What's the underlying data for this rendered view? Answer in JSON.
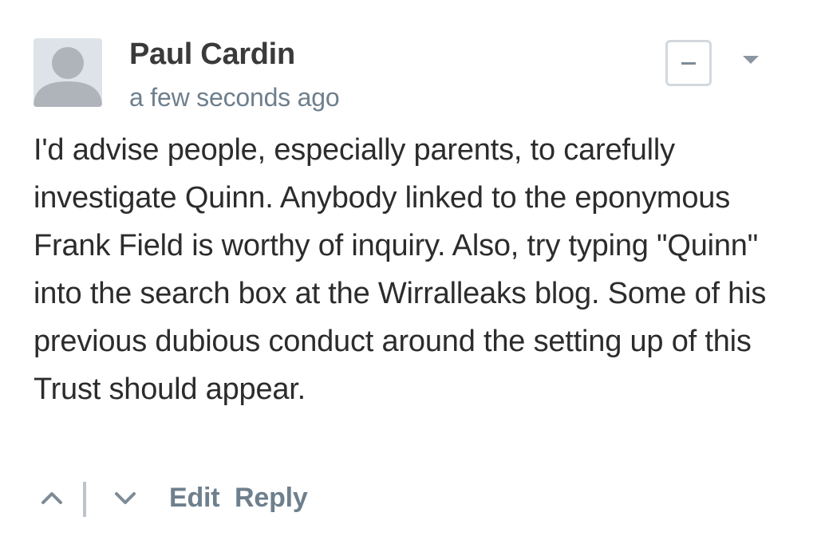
{
  "comment": {
    "author": "Paul Cardin",
    "timestamp": "a few seconds ago",
    "body": "I'd advise people, especially parents, to carefully investigate Quinn. Anybody linked to the eponymous Frank Field is worthy of inquiry. Also, try typing \"Quinn\" into the search box at the Wirralleaks blog. Some of his previous dubious conduct around the setting up of this Trust should appear.",
    "collapse_icon": "minus-icon",
    "menu_icon": "chevron-down-icon",
    "avatar_icon": "user-silhouette-icon"
  },
  "actions": {
    "upvote_icon": "chevron-up-icon",
    "downvote_icon": "chevron-down-icon",
    "edit_label": "Edit",
    "reply_label": "Reply"
  },
  "colors": {
    "author": "#3a3a3a",
    "meta": "#6e7f8d",
    "body": "#2c2c2c",
    "border": "#d2d8de",
    "avatar_bg": "#dde3e8",
    "avatar_fg": "#aeb4b9"
  }
}
